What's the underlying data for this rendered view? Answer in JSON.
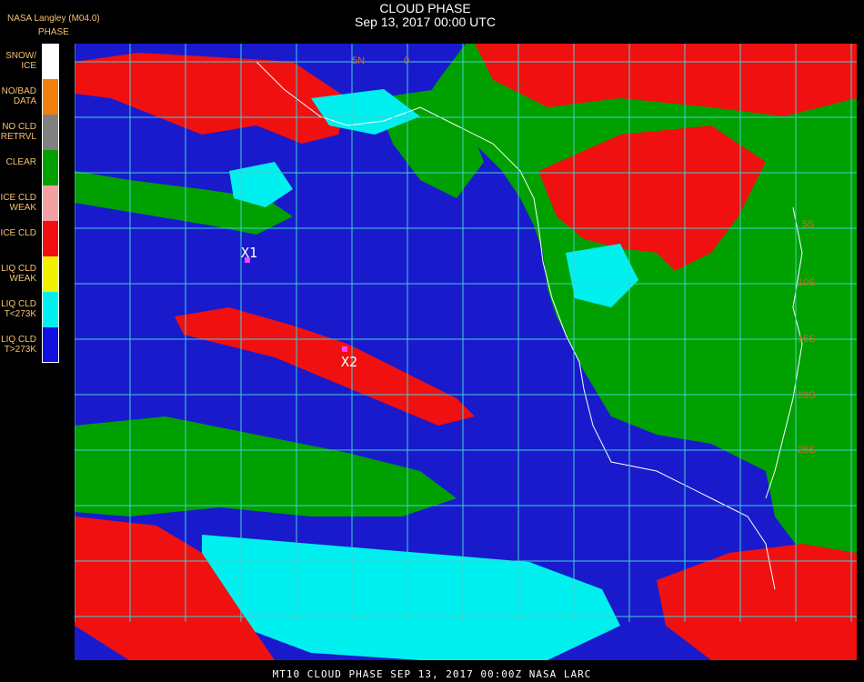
{
  "header": {
    "source": "NASA Langley (M04.0)",
    "product": "PHASE"
  },
  "title": {
    "main": "CLOUD PHASE",
    "date": "Sep 13, 2017 00:00 UTC"
  },
  "legend": [
    {
      "label": "SNOW/\nICE",
      "color": "#ffffff"
    },
    {
      "label": "NO/BAD\nDATA",
      "color": "#f07f0e"
    },
    {
      "label": "NO CLD\nRETRVL",
      "color": "#808080"
    },
    {
      "label": "CLEAR",
      "color": "#00a000"
    },
    {
      "label": "ICE CLD\nWEAK",
      "color": "#f4a0a0"
    },
    {
      "label": "ICE CLD",
      "color": "#f01010"
    },
    {
      "label": "LIQ CLD\nWEAK",
      "color": "#f0f000"
    },
    {
      "label": "LIQ CLD\nT<273K",
      "color": "#00f0f0"
    },
    {
      "label": "LIQ CLD\nT>273K",
      "color": "#1010e0"
    }
  ],
  "map": {
    "markers": [
      {
        "label": "X1",
        "color": "#ff40ff"
      },
      {
        "label": "X2",
        "color": "#ff40ff"
      }
    ],
    "lat_labels": [
      "5N",
      "0",
      "5S",
      "10S",
      "15S",
      "20S",
      "25S"
    ],
    "colors": {
      "ocean": "#1a1acd",
      "ice": "#f01010",
      "clear": "#00a000",
      "liquid": "#00f0f0",
      "grid": "#40d0d0",
      "coast": "#ffffff"
    }
  },
  "footer": "MT10  CLOUD PHASE   SEP 13, 2017 00:00Z   NASA LARC"
}
